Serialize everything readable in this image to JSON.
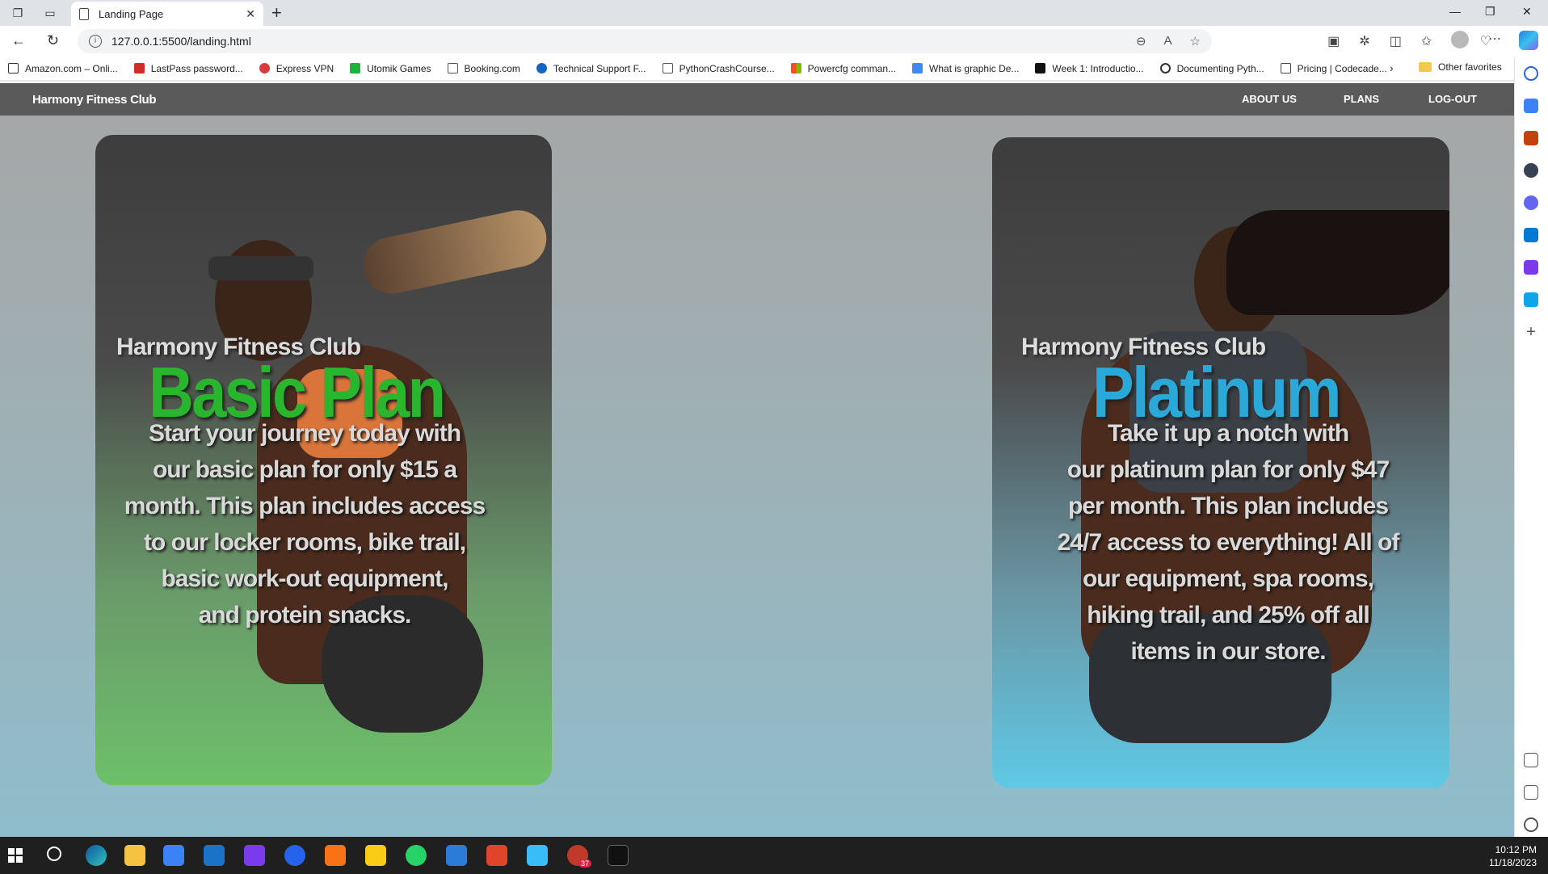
{
  "browser": {
    "tab_title": "Landing Page",
    "url": "127.0.0.1:5500/landing.html",
    "bookmarks": [
      {
        "label": "Amazon.com – Onli...",
        "color": "#333333"
      },
      {
        "label": "LastPass password...",
        "color": "#d32d27"
      },
      {
        "label": "Express VPN",
        "color": "#da3940"
      },
      {
        "label": "Utomik Games",
        "color": "#1fb141"
      },
      {
        "label": "Booking.com",
        "color": "#555555"
      },
      {
        "label": "Technical Support F...",
        "color": "#1565c0"
      },
      {
        "label": "PythonCrashCourse...",
        "color": "#555555"
      },
      {
        "label": "Powercfg comman...",
        "color": "#f25022"
      },
      {
        "label": "What is graphic De...",
        "color": "#4285f4"
      },
      {
        "label": "Week 1: Introductio...",
        "color": "#111111"
      },
      {
        "label": "Documenting Pyth...",
        "color": "#333333"
      },
      {
        "label": "Pricing | Codecade...",
        "color": "#444444"
      }
    ],
    "other_favorites": "Other favorites"
  },
  "site": {
    "brand": "Harmony Fitness Club",
    "nav": [
      "ABOUT US",
      "PLANS",
      "LOG-OUT"
    ]
  },
  "cards": {
    "basic": {
      "subtitle": "Harmony Fitness Club",
      "title": "Basic Plan",
      "title_color": "#2ab52e",
      "desc_lines": [
        "Start your journey today with",
        "our basic plan for only $15 a",
        "month. This plan includes access",
        "to our locker rooms, bike trail,",
        "basic work-out equipment,",
        "and protein snacks."
      ]
    },
    "platinum": {
      "subtitle": "Harmony Fitness Club",
      "title": "Platinum",
      "title_color": "#2aa8d8",
      "desc_lines": [
        "Take it up a notch with",
        "our platinum plan for only $47",
        "per month. This plan includes",
        "24/7 access to everything! All of",
        "our equipment, spa rooms,",
        "hiking trail, and 25% off all",
        "items in our store."
      ]
    }
  },
  "taskbar": {
    "time": "10:12 PM",
    "date": "11/18/2023",
    "badge": "37"
  }
}
